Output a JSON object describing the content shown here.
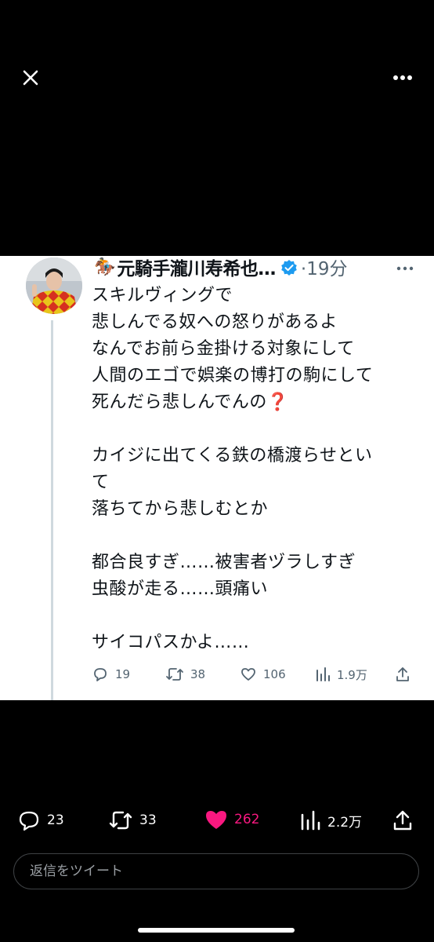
{
  "viewer": {
    "close_icon": "close-icon",
    "more_icon": "more-horizontal-icon"
  },
  "tweet": {
    "author_prefix_emoji": "🏇",
    "author": "元騎手瀧川寿希也…",
    "time": "·19分",
    "body": "スキルヴィングで\n悲しんでる奴への怒りがあるよ\nなんでお前ら金掛ける対象にして\n人間のエゴで娯楽の博打の駒にして\n死んだら悲しんでんの❓\n\nカイジに出てくる鉄の橋渡らせとい\nて\n落ちてから悲しむとか\n\n都合良すぎ……被害者ヅラしすぎ\n虫酸が走る……頭痛い\n\nサイコパスかよ……",
    "actions": {
      "replies": "19",
      "retweets": "38",
      "likes": "106",
      "views": "1.9万"
    },
    "colors": {
      "verified": "#1d9bf0",
      "text": "#0f1419",
      "muted": "#536471"
    }
  },
  "post_actions": {
    "replies": "23",
    "retweets": "33",
    "likes": "262",
    "views": "2.2万",
    "like_color": "#f91880"
  },
  "reply_box": {
    "placeholder": "返信をツイート"
  }
}
